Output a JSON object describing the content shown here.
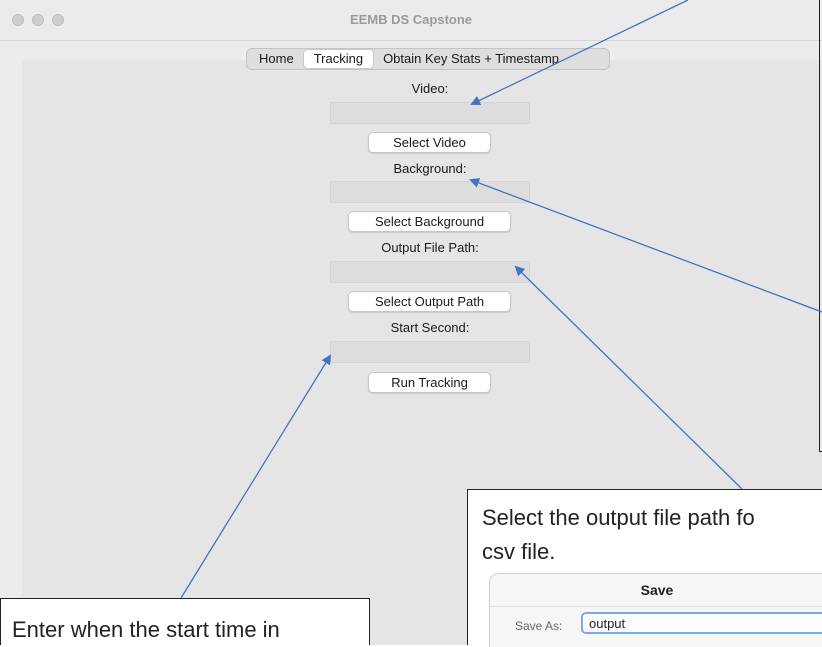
{
  "window": {
    "title": "EEMB DS Capstone"
  },
  "tabs": [
    {
      "label": "Home",
      "active": false
    },
    {
      "label": "Tracking",
      "active": true
    },
    {
      "label": "Obtain Key Stats + Timestamp",
      "active": false
    }
  ],
  "form": {
    "video_label": "Video:",
    "video_value": "",
    "select_video_label": "Select Video",
    "background_label": "Background:",
    "background_value": "",
    "select_background_label": "Select Background",
    "output_label": "Output File Path:",
    "output_value": "",
    "select_output_label": "Select Output Path",
    "start_label": "Start Second:",
    "start_value": "",
    "run_label": "Run Tracking"
  },
  "annotations": {
    "output_note": "Select the output file path fo",
    "output_note_2": "csv file.",
    "start_note": "Enter when the start time in",
    "save_dialog": {
      "title": "Save",
      "save_as_label": "Save As:",
      "save_as_value": "output"
    }
  },
  "colors": {
    "arrow": "#4472c4",
    "accent": "#3b82f6"
  }
}
